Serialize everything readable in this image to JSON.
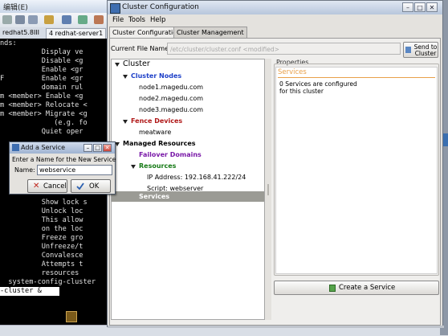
{
  "host": {
    "title": "编辑(E)",
    "tabs": [
      "redhat5.8III",
      "4 redhat-server1"
    ],
    "terminal_lines": [
      "nds:",
      "          Display ve",
      "          Disable <g",
      "          Enable <gr",
      "F         Enable <gr",
      "          domain rul",
      "m <member> Enable <g",
      "m <member> Relocate <",
      "m <member> Migrate <g",
      "             (e.g. fo",
      "          Quiet oper",
      "",
      "",
      "",
      "",
      "",
      "",
      "",
      "          Show lock s",
      "          Unlock loc",
      "          This allow",
      "          on the loc",
      "          Freeze gro",
      "          Unfreeze/t",
      "          Convalesce",
      "          Attempts t",
      "          resources",
      "  system-config-cluster",
      "-cluster &"
    ]
  },
  "window": {
    "title": "Cluster Configuration",
    "menu": [
      "File",
      "Tools",
      "Help"
    ],
    "tabs": [
      "Cluster Configuration",
      "Cluster Management"
    ],
    "file_label": "Current File Name:",
    "file_value": "/etc/cluster/cluster.conf <modified>",
    "send_button": "Send to Cluster",
    "tree": {
      "root": "Cluster",
      "cluster_nodes_label": "Cluster Nodes",
      "nodes": [
        "node1.magedu.com",
        "node2.magedu.com",
        "node3.magedu.com"
      ],
      "fence_devices_label": "Fence Devices",
      "fence_devices": [
        "meatware"
      ],
      "managed_resources_label": "Managed Resources",
      "failover_domains_label": "Failover Domains",
      "resources_label": "Resources",
      "resources": [
        "IP Address: 192.168.41.222/24",
        "Script: webserver"
      ],
      "services_label": "Services"
    },
    "properties": {
      "label": "Properties",
      "title": "Services",
      "text_line1": "0 Services are configured",
      "text_line2": "for this cluster"
    },
    "create_service_button": "Create a Service"
  },
  "dialog": {
    "title": "Add a Service",
    "prompt": "Enter a Name for the New Service",
    "name_label": "Name:",
    "name_value": "webservice",
    "cancel": "Cancel",
    "ok": "OK"
  },
  "colors": {
    "cluster_nodes": "#1e40c8",
    "fence_devices": "#b01818",
    "failover_domains": "#7a1aa8",
    "resources": "#167a16",
    "properties_accent": "#e8a04a",
    "selection": "#9b9b95"
  }
}
